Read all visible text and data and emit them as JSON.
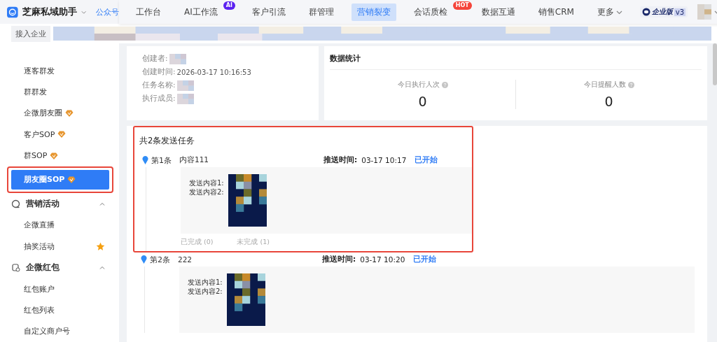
{
  "app": {
    "name": "芝麻私域助手",
    "account_link": "公众号"
  },
  "nav": [
    {
      "label": "工作台",
      "selected": false
    },
    {
      "label": "AI工作流",
      "selected": false,
      "badge": {
        "text": "AI",
        "kind": "ai"
      }
    },
    {
      "label": "客户引流",
      "selected": false
    },
    {
      "label": "群管理",
      "selected": false
    },
    {
      "label": "营销裂变",
      "selected": true
    },
    {
      "label": "会话质检",
      "selected": false,
      "badge": {
        "text": "HOT",
        "kind": "hot"
      }
    },
    {
      "label": "数据互通",
      "selected": false
    },
    {
      "label": "销售CRM",
      "selected": false
    },
    {
      "label": "更多",
      "selected": false,
      "dropdown": true
    }
  ],
  "edition": {
    "label": "企业版",
    "version": "v3"
  },
  "subbar": {
    "chip": "接入企业"
  },
  "sidebar": {
    "items": [
      {
        "kind": "link",
        "label": "逐客群发",
        "selected": false
      },
      {
        "kind": "link",
        "label": "群群发",
        "selected": false
      },
      {
        "kind": "vip-link",
        "label": "企微朋友圈",
        "selected": false
      },
      {
        "kind": "vip-link",
        "label": "客户SOP",
        "selected": false
      },
      {
        "kind": "vip-link",
        "label": "群SOP",
        "selected": false
      },
      {
        "kind": "vip-link",
        "label": "朋友圈SOP",
        "selected": true
      },
      {
        "kind": "group",
        "label": "营销活动",
        "expanded": true
      },
      {
        "kind": "link",
        "label": "企微直播",
        "selected": false
      },
      {
        "kind": "star-link",
        "label": "抽奖活动",
        "selected": false
      },
      {
        "kind": "group",
        "label": "企微红包",
        "expanded": true
      },
      {
        "kind": "link",
        "label": "红包账户",
        "selected": false
      },
      {
        "kind": "link",
        "label": "红包列表",
        "selected": false
      },
      {
        "kind": "link",
        "label": "自定义商户号",
        "selected": false
      }
    ]
  },
  "info": [
    {
      "label": "创建者:",
      "kind": "picture"
    },
    {
      "label": "创建时间:",
      "value": "2026-03-17 10:16:53"
    },
    {
      "label": "任务名称:",
      "kind": "picture"
    },
    {
      "label": "执行成员:",
      "kind": "picture"
    }
  ],
  "stats": {
    "title": "数据统计",
    "items": [
      {
        "label": "今日执行人次",
        "value": "0"
      },
      {
        "label": "今日提醒人数",
        "value": "0"
      }
    ]
  },
  "tasks": {
    "title": "共2条发送任务",
    "items": [
      {
        "index": "第1条",
        "content": "内容111",
        "time_label": "推送时间:",
        "time": "03-17 10:17",
        "status": "已开始",
        "lines": [
          "发送内容1:",
          "发送内容2:"
        ],
        "done": "已完成 (0)",
        "undone": "未完成 (1)",
        "highlighted": true
      },
      {
        "index": "第2条",
        "content": "222",
        "time_label": "推送时间:",
        "time": "03-17 10:20",
        "status": "已开始",
        "lines": [
          "发送内容1:",
          "发送内容2:"
        ],
        "highlighted": false
      }
    ]
  }
}
